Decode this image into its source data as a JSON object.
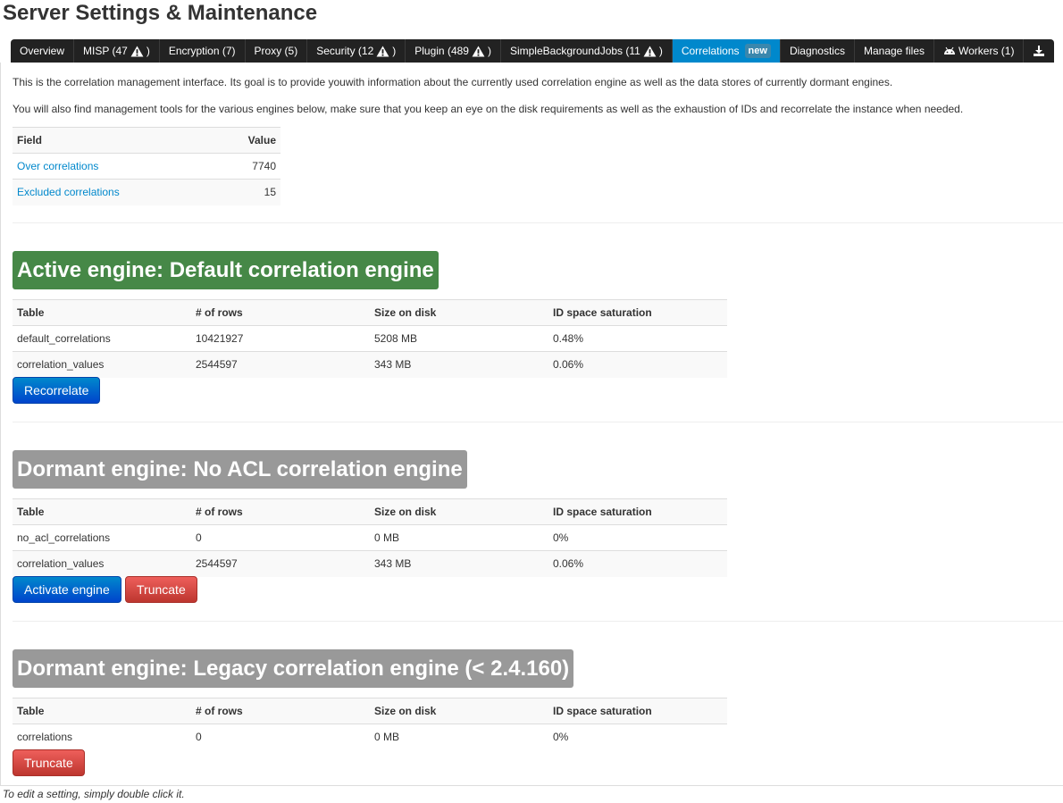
{
  "page_title": "Server Settings & Maintenance",
  "tabs": [
    {
      "label": "Overview",
      "warn": false
    },
    {
      "label": "MISP (47",
      "warn": true
    },
    {
      "label": "Encryption (7)",
      "warn": false
    },
    {
      "label": "Proxy (5)",
      "warn": false
    },
    {
      "label": "Security (12",
      "warn": true
    },
    {
      "label": "Plugin (489",
      "warn": true
    },
    {
      "label": "SimpleBackgroundJobs (11",
      "warn": true
    },
    {
      "label": "Correlations",
      "badge": "new",
      "active": true
    },
    {
      "label": "Diagnostics",
      "warn": false
    },
    {
      "label": "Manage files",
      "warn": false
    },
    {
      "label": "Workers (1)",
      "icon": "android-icon"
    },
    {
      "label": "",
      "icon": "download-icon"
    }
  ],
  "intro": {
    "line1": "This is the correlation management interface. Its goal is to provide youwith information about the currently used correlation engine as well as the data stores of currently dormant engines.",
    "line2": "You will also find management tools for the various engines below, make sure that you keep an eye on the disk requirements as well as the exhaustion of IDs and recorrelate the instance when needed."
  },
  "summary_table": {
    "headers": [
      "Field",
      "Value"
    ],
    "rows": [
      {
        "field": "Over correlations",
        "value": "7740"
      },
      {
        "field": "Excluded correlations",
        "value": "15"
      }
    ]
  },
  "engines": [
    {
      "title": "Active engine: Default correlation engine",
      "status": "active",
      "headers": [
        "Table",
        "# of rows",
        "Size on disk",
        "ID space saturation"
      ],
      "rows": [
        [
          "default_correlations",
          "10421927",
          "5208 MB",
          "0.48%"
        ],
        [
          "correlation_values",
          "2544597",
          "343 MB",
          "0.06%"
        ]
      ],
      "buttons": [
        "Recorrelate"
      ]
    },
    {
      "title": "Dormant engine: No ACL correlation engine",
      "status": "dormant",
      "headers": [
        "Table",
        "# of rows",
        "Size on disk",
        "ID space saturation"
      ],
      "rows": [
        [
          "no_acl_correlations",
          "0",
          "0 MB",
          "0%"
        ],
        [
          "correlation_values",
          "2544597",
          "343 MB",
          "0.06%"
        ]
      ],
      "buttons": [
        "Activate engine",
        "Truncate"
      ]
    },
    {
      "title": "Dormant engine: Legacy correlation engine (< 2.4.160)",
      "status": "dormant",
      "headers": [
        "Table",
        "# of rows",
        "Size on disk",
        "ID space saturation"
      ],
      "rows": [
        [
          "correlations",
          "0",
          "0 MB",
          "0%"
        ]
      ],
      "buttons": [
        "Truncate"
      ]
    }
  ],
  "footer_note": "To edit a setting, simply double click it.",
  "colors": {
    "tab_bar": "#222222",
    "tab_active": "#0088cc",
    "link": "#0088cc",
    "active_engine": "#468847",
    "dormant_engine": "#999999",
    "btn_primary": "#0055cc",
    "btn_danger": "#da4f49"
  }
}
